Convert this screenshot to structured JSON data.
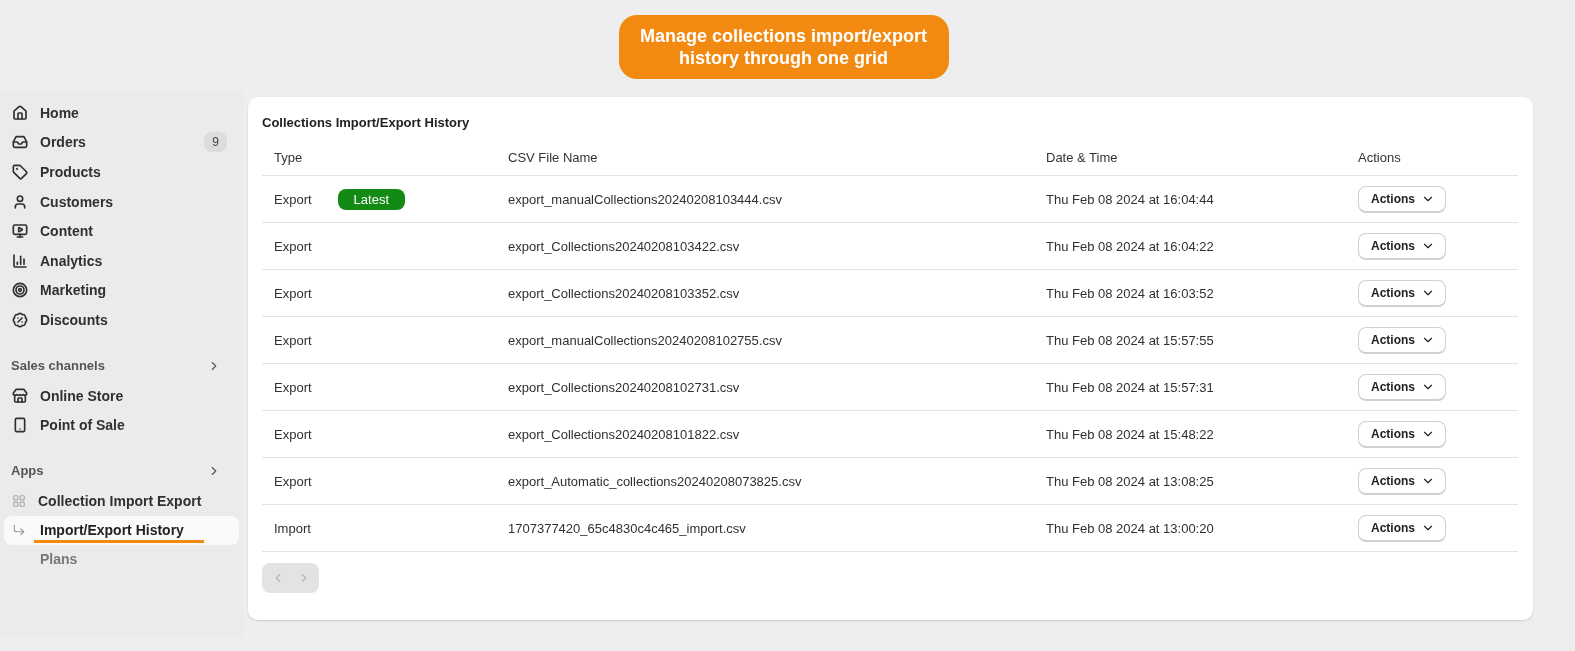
{
  "callout": "Manage collections import/export history through one grid",
  "sidebar": {
    "items": [
      {
        "label": "Home"
      },
      {
        "label": "Orders",
        "badge": "9"
      },
      {
        "label": "Products"
      },
      {
        "label": "Customers"
      },
      {
        "label": "Content"
      },
      {
        "label": "Analytics"
      },
      {
        "label": "Marketing"
      },
      {
        "label": "Discounts"
      }
    ],
    "sales_channels": {
      "title": "Sales channels",
      "items": [
        {
          "label": "Online Store"
        },
        {
          "label": "Point of Sale"
        }
      ]
    },
    "apps": {
      "title": "Apps",
      "app": "Collection Import Export",
      "children": [
        {
          "label": "Import/Export History",
          "selected": true
        },
        {
          "label": "Plans",
          "selected": false
        }
      ]
    }
  },
  "card": {
    "title": "Collections Import/Export History",
    "columns": [
      "Type",
      "CSV File Name",
      "Date & Time",
      "Actions"
    ],
    "rows": [
      {
        "type": "Export",
        "badge": "Latest",
        "file": "export_manualCollections20240208103444.csv",
        "date": "Thu Feb 08 2024 at 16:04:44",
        "action": "Actions"
      },
      {
        "type": "Export",
        "file": "export_Collections20240208103422.csv",
        "date": "Thu Feb 08 2024 at 16:04:22",
        "action": "Actions"
      },
      {
        "type": "Export",
        "file": "export_Collections20240208103352.csv",
        "date": "Thu Feb 08 2024 at 16:03:52",
        "action": "Actions"
      },
      {
        "type": "Export",
        "file": "export_manualCollections20240208102755.csv",
        "date": "Thu Feb 08 2024 at 15:57:55",
        "action": "Actions"
      },
      {
        "type": "Export",
        "file": "export_Collections20240208102731.csv",
        "date": "Thu Feb 08 2024 at 15:57:31",
        "action": "Actions"
      },
      {
        "type": "Export",
        "file": "export_Collections20240208101822.csv",
        "date": "Thu Feb 08 2024 at 15:48:22",
        "action": "Actions"
      },
      {
        "type": "Export",
        "file": "export_Automatic_collections20240208073825.csv",
        "date": "Thu Feb 08 2024 at 13:08:25",
        "action": "Actions"
      },
      {
        "type": "Import",
        "file": "1707377420_65c4830c4c465_import.csv",
        "date": "Thu Feb 08 2024 at 13:00:20",
        "action": "Actions"
      }
    ],
    "pagination": {
      "disabled": true
    }
  }
}
